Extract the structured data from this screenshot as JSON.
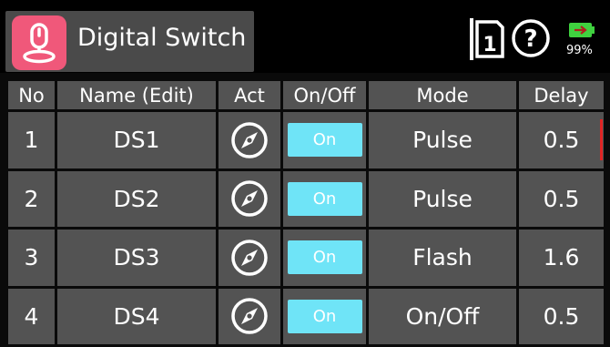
{
  "header": {
    "title": "Digital Switch",
    "app_icon": "switch-icon",
    "model_number": "1",
    "help_glyph": "?",
    "battery_text": "99%",
    "colors": {
      "accent": "#f0587a",
      "toggle": "#6fe4f7",
      "battery": "#3fd13f",
      "marker": "#e02525"
    }
  },
  "table": {
    "columns": [
      "No",
      "Name (Edit)",
      "Act",
      "On/Off",
      "Mode",
      "Delay"
    ],
    "rows": [
      {
        "no": "1",
        "name": "DS1",
        "act": "compass-dial-icon",
        "onoff": "On",
        "mode": "Pulse",
        "delay": "0.5"
      },
      {
        "no": "2",
        "name": "DS2",
        "act": "compass-dial-icon",
        "onoff": "On",
        "mode": "Pulse",
        "delay": "0.5"
      },
      {
        "no": "3",
        "name": "DS3",
        "act": "compass-dial-icon",
        "onoff": "On",
        "mode": "Flash",
        "delay": "1.6"
      },
      {
        "no": "4",
        "name": "DS4",
        "act": "compass-dial-icon",
        "onoff": "On",
        "mode": "On/Off",
        "delay": "0.5"
      }
    ]
  }
}
